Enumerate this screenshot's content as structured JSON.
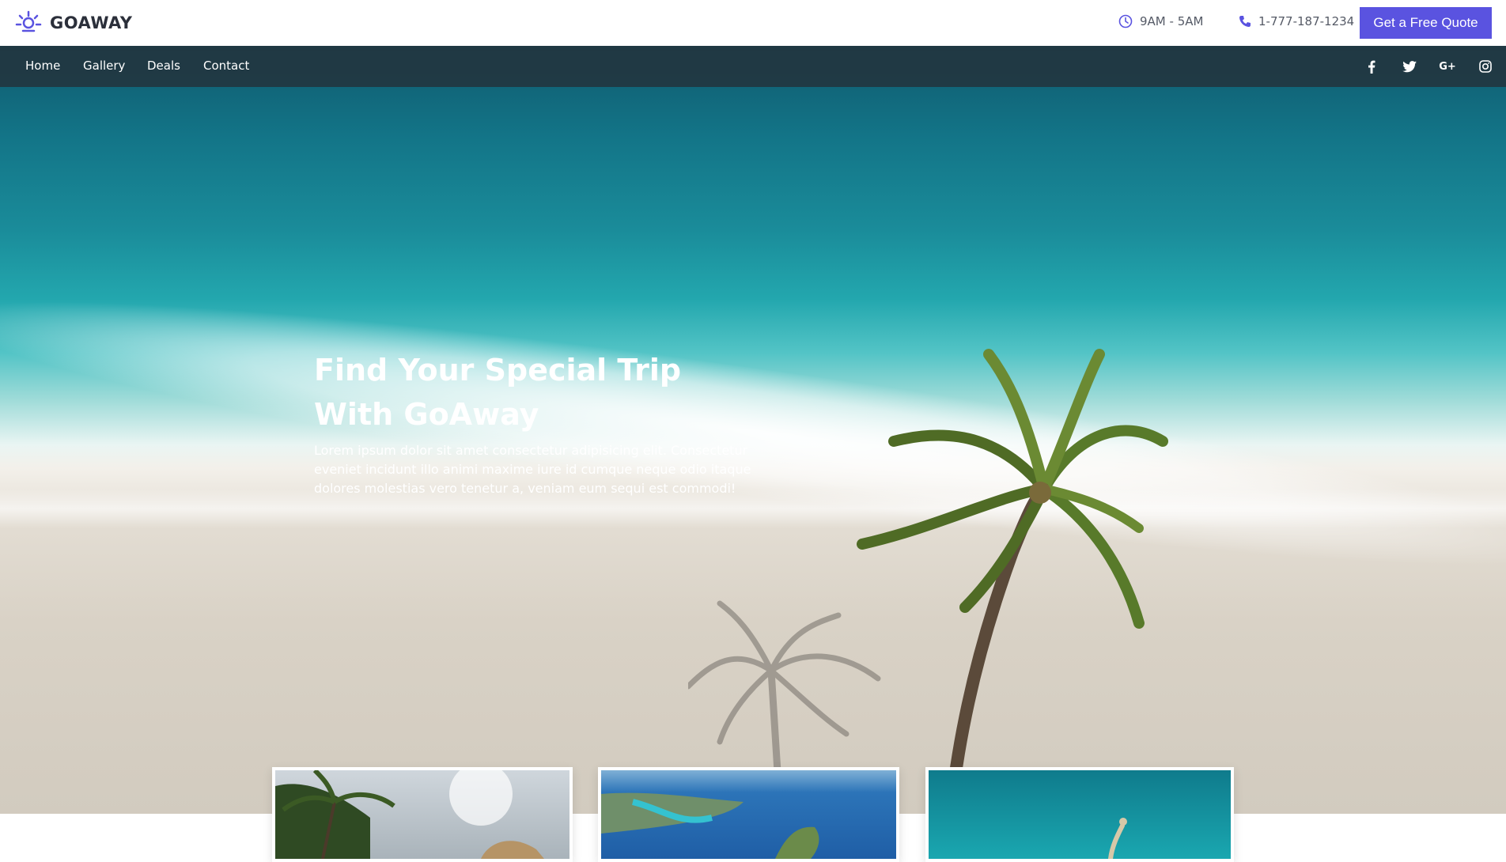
{
  "brand": {
    "name": "GOAWAY",
    "icon": "sun-logo-icon"
  },
  "header": {
    "hours": "9AM - 5AM",
    "phone": "1-777-187-1234",
    "quote_button": "Get a Free Quote"
  },
  "nav": {
    "items": [
      {
        "label": "Home"
      },
      {
        "label": "Gallery"
      },
      {
        "label": "Deals"
      },
      {
        "label": "Contact"
      }
    ],
    "social": [
      {
        "icon": "facebook-icon",
        "glyph": "f"
      },
      {
        "icon": "twitter-icon",
        "glyph": "🐦"
      },
      {
        "icon": "google-plus-icon",
        "glyph": "G+"
      },
      {
        "icon": "instagram-icon",
        "glyph": "◎"
      }
    ]
  },
  "hero": {
    "title_line1": "Find Your Special Trip",
    "title_line2": "With GoAway",
    "description": "Lorem ipsum dolor sit amet consectetur adipisicing elit. Consectetur eveniet incidunt illo animi maxime iure id cumque neque odio itaque dolores molestias vero tenetur a, veniam eum sequi est commodi!"
  },
  "cards": [
    {
      "name": "tropical-beach-card"
    },
    {
      "name": "island-aerial-card"
    },
    {
      "name": "underwater-swim-card"
    }
  ],
  "colors": {
    "accent": "#5a53e0",
    "nav_bg": "#23323c",
    "text_dark": "#2b2f3a"
  }
}
